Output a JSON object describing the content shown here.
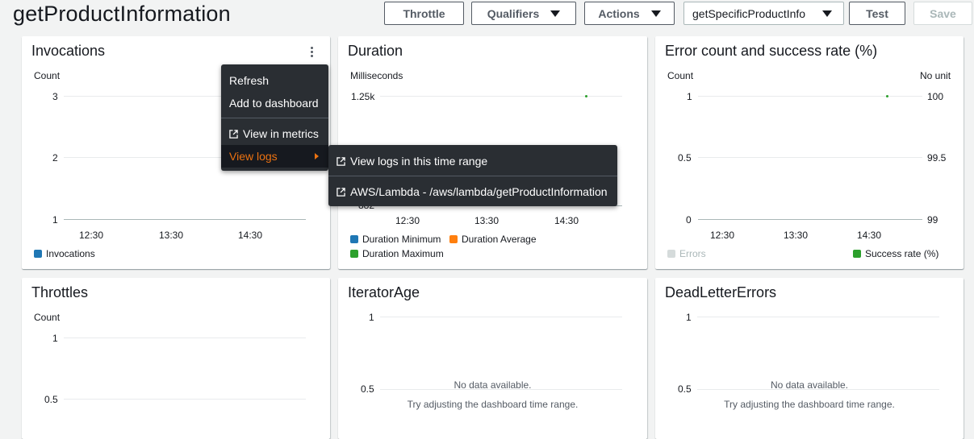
{
  "header": {
    "title": "getProductInformation",
    "throttle_label": "Throttle",
    "qualifiers_label": "Qualifiers",
    "actions_label": "Actions",
    "alias_select": "getSpecificProductInfo",
    "test_label": "Test",
    "save_label": "Save"
  },
  "cards": {
    "invocations": {
      "title": "Invocations",
      "unit": "Count",
      "yticks": [
        "3",
        "2",
        "1"
      ],
      "xticks": [
        "12:30",
        "13:30",
        "14:30"
      ],
      "legend": [
        "Invocations"
      ]
    },
    "duration": {
      "title": "Duration",
      "unit": "Milliseconds",
      "ytick_top": "1.25k",
      "ytick_bottom_partial": "882",
      "xticks": [
        "12:30",
        "13:30",
        "14:30"
      ],
      "legend": [
        "Duration Minimum",
        "Duration Average",
        "Duration Maximum"
      ]
    },
    "errors": {
      "title": "Error count and success rate (%)",
      "unit_left": "Count",
      "unit_right": "No unit",
      "yticks_left": [
        "1",
        "0.5",
        "0"
      ],
      "yticks_right": [
        "100",
        "99.5",
        "99"
      ],
      "xticks": [
        "12:30",
        "13:30",
        "14:30"
      ],
      "legend": [
        "Errors",
        "Success rate (%)"
      ]
    },
    "throttles": {
      "title": "Throttles",
      "unit": "Count",
      "yticks": [
        "1",
        "0.5"
      ]
    },
    "iterator_age": {
      "title": "IteratorAge",
      "yticks": [
        "1",
        "0.5"
      ],
      "nodata": "No data available.",
      "nodata_hint": "Try adjusting the dashboard time range."
    },
    "dead_letter": {
      "title": "DeadLetterErrors",
      "yticks": [
        "1",
        "0.5"
      ],
      "nodata": "No data available.",
      "nodata_hint": "Try adjusting the dashboard time range."
    }
  },
  "context_menu": {
    "refresh": "Refresh",
    "add_to_dashboard": "Add to dashboard",
    "view_in_metrics": "View in metrics",
    "view_logs": "View logs"
  },
  "submenu": {
    "view_logs_range": "View logs in this time range",
    "log_group": "AWS/Lambda - /aws/lambda/getProductInformation"
  },
  "colors": {
    "blue": "#1f77b4",
    "orange": "#ff7f0e",
    "green": "#2ca02c",
    "disabled": "#d5dbdb",
    "accent": "#ec7211"
  }
}
